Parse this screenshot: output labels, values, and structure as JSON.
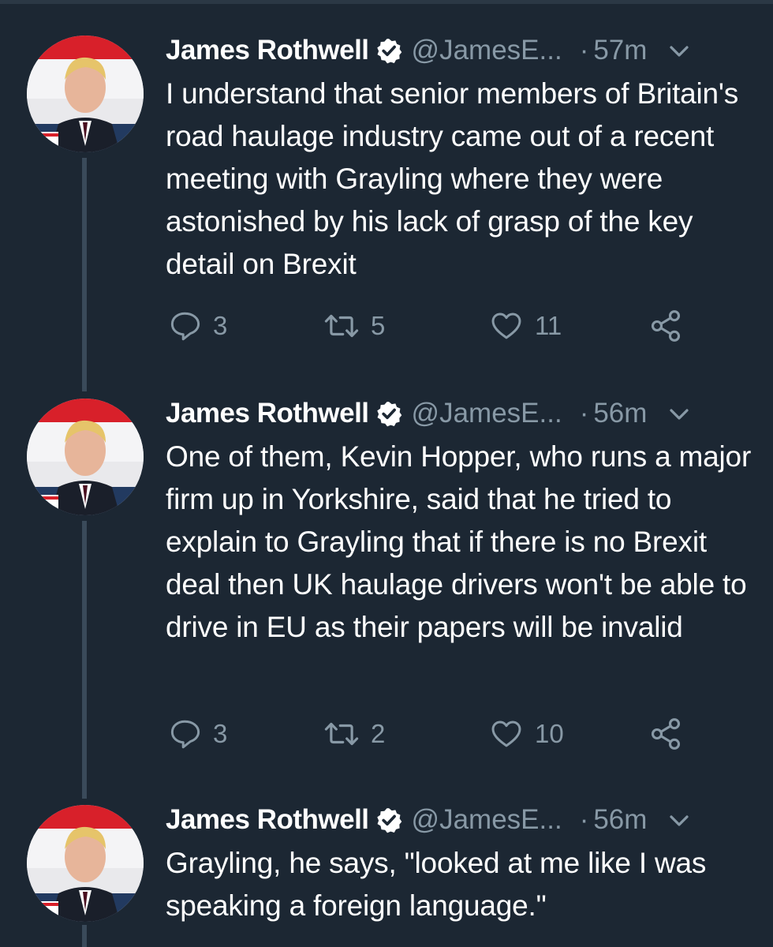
{
  "colors": {
    "background": "#1c2733",
    "text": "#ffffff",
    "muted": "#8899a6",
    "thread_line": "#3a4a5a",
    "verified": "#ffffff"
  },
  "tweets": [
    {
      "name": "James Rothwell",
      "handle": "@JamesE...",
      "time": "57m",
      "text": "I understand that senior members of Britain's road haulage industry came out of a recent meeting with Grayling where they were astonished by his lack of grasp of the key detail on Brexit",
      "replies": "3",
      "retweets": "5",
      "likes": "11"
    },
    {
      "name": "James Rothwell",
      "handle": "@JamesE...",
      "time": "56m",
      "text": "One of them, Kevin Hopper, who runs a major firm up in Yorkshire, said that he tried to explain to Grayling that if there is no Brexit deal then UK haulage drivers won't be able to drive in EU as their papers will be invalid",
      "replies": "3",
      "retweets": "2",
      "likes": "10"
    },
    {
      "name": "James Rothwell",
      "handle": "@JamesE...",
      "time": "56m",
      "text": "Grayling, he says, \"looked at me like I was speaking a foreign language.\""
    }
  ],
  "icons": {
    "verified": "verified-badge-icon",
    "more": "chevron-down-icon",
    "reply": "reply-icon",
    "retweet": "retweet-icon",
    "like": "heart-icon",
    "share": "share-icon"
  }
}
